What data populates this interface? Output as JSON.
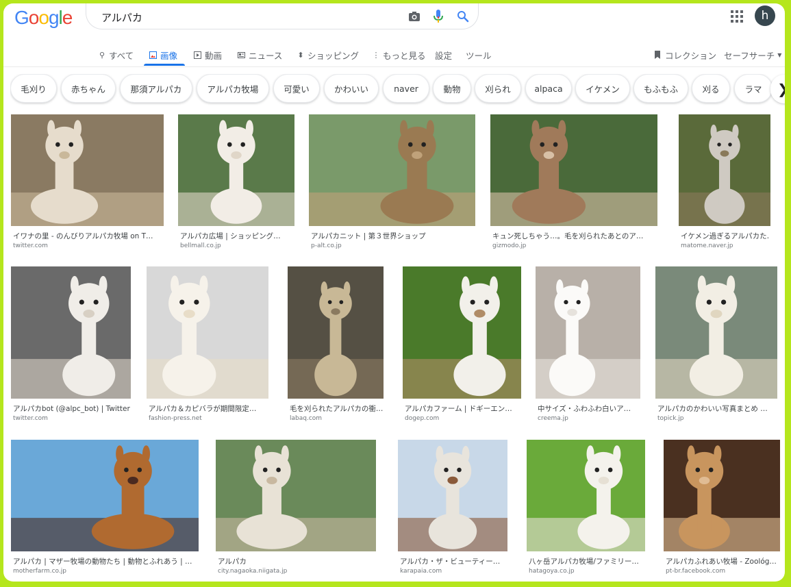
{
  "search": {
    "query": "アルパカ"
  },
  "header": {
    "avatar_letter": "h"
  },
  "tabs": {
    "all": "すべて",
    "images": "画像",
    "videos": "動画",
    "news": "ニュース",
    "shopping": "ショッピング",
    "more": "もっと見る",
    "settings": "設定",
    "tools": "ツール",
    "collection": "コレクション",
    "safesearch": "セーフサーチ"
  },
  "chips": [
    "毛刈り",
    "赤ちゃん",
    "那須アルパカ",
    "アルパカ牧場",
    "可愛い",
    "かわいい",
    "naver",
    "動物",
    "刈られ",
    "alpaca",
    "イケメン",
    "もふもふ",
    "刈る",
    "ラマ"
  ],
  "results": [
    {
      "caption": "イワナの里 - のんびりアルパカ牧場 on T…",
      "source": "twitter.com"
    },
    {
      "caption": "アルパカ広場 | ショッピング…",
      "source": "bellmall.co.jp"
    },
    {
      "caption": "アルパカニット | 第３世界ショップ",
      "source": "p-alt.co.jp"
    },
    {
      "caption": "キュン死しちゃう…。毛を刈られたあとのア…",
      "source": "gizmodo.jp"
    },
    {
      "caption": "イケメン過ぎるアルパカた…",
      "source": "matome.naver.jp"
    },
    {
      "caption": "アルパカbot (@alpc_bot) | Twitter",
      "source": "twitter.com"
    },
    {
      "caption": "アルパカ＆カピバラが期間限定…",
      "source": "fashion-press.net"
    },
    {
      "caption": "毛を刈られたアルパカの衝…",
      "source": "labaq.com"
    },
    {
      "caption": "アルパカファーム | ドギーエン…",
      "source": "dogep.com"
    },
    {
      "caption": "中サイズ・ふわふわ白いア…",
      "source": "creema.jp"
    },
    {
      "caption": "アルパカのかわいい写真まとめ …",
      "source": "topick.jp"
    },
    {
      "caption": "アルパカ | マザー牧場の動物たち | 動物とふれあう | …",
      "source": "motherfarm.co.jp"
    },
    {
      "caption": "アルパカ",
      "source": "city.nagaoka.niigata.jp"
    },
    {
      "caption": "アルパカ・ザ・ビューティー…",
      "source": "karapaia.com"
    },
    {
      "caption": "八ヶ岳アルパカ牧場/ファミリー…",
      "source": "hatagoya.co.jp"
    },
    {
      "caption": "アルパカふれあい牧場 - Zoológ…",
      "source": "pt-br.facebook.com"
    }
  ]
}
